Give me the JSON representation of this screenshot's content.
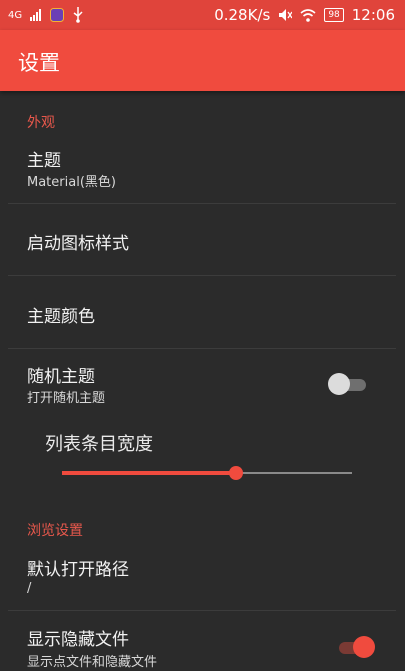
{
  "status_bar": {
    "network": "4G",
    "speed": "0.28K/s",
    "battery": "98",
    "time": "12:06"
  },
  "app_bar": {
    "title": "设置"
  },
  "sections": {
    "appearance": {
      "header": "外观",
      "theme": {
        "title": "主题",
        "subtitle": "Material(黑色)"
      },
      "launcher_icon_style": {
        "title": "启动图标样式"
      },
      "theme_color": {
        "title": "主题颜色"
      },
      "random_theme": {
        "title": "随机主题",
        "subtitle": "打开随机主题",
        "enabled": false
      },
      "list_item_width": {
        "label": "列表条目宽度",
        "value": 0.6
      }
    },
    "browse": {
      "header": "浏览设置",
      "default_path": {
        "title": "默认打开路径",
        "subtitle": "/"
      },
      "show_hidden": {
        "title": "显示隐藏文件",
        "subtitle": "显示点文件和隐藏文件",
        "enabled": true
      }
    }
  },
  "colors": {
    "accent": "#f04b3e",
    "background": "#2b2b2b",
    "status_bar": "#e0443b"
  }
}
